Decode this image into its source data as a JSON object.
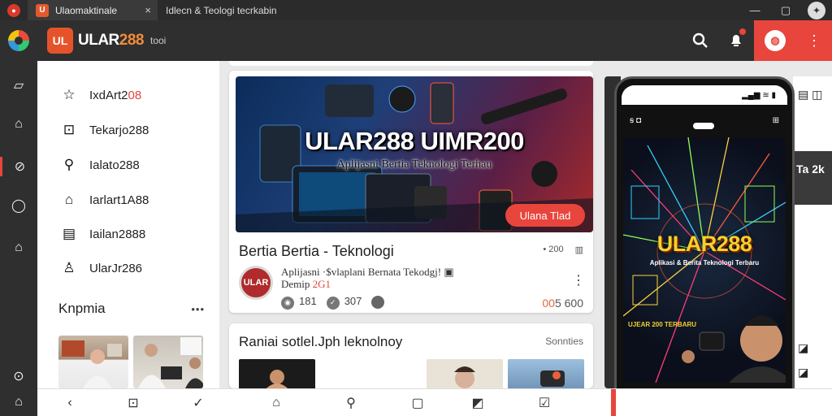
{
  "browser": {
    "tabs": [
      {
        "label": "Ulaomaktinale"
      },
      {
        "label": "Idlecn & Teologi tecrkabin"
      }
    ],
    "close_glyph": "×",
    "window_controls": [
      "—",
      "▢"
    ]
  },
  "header": {
    "brand_mark": "UL",
    "brand_name_a": "ULAR",
    "brand_name_b": "288",
    "brand_sub": "tooi",
    "icons": [
      "search-icon",
      "notification-icon",
      "profile-icon",
      "more-icon"
    ]
  },
  "sidebar": {
    "items": [
      {
        "icon": "star-icon",
        "glyph": "☆",
        "label_a": "IxdArt2",
        "label_b": "08"
      },
      {
        "icon": "bookmark-icon",
        "glyph": "⊡",
        "label_a": "Tekarjo288",
        "label_b": ""
      },
      {
        "icon": "user-icon",
        "glyph": "⚲",
        "label_a": "Ialato288",
        "label_b": ""
      },
      {
        "icon": "lock-icon",
        "glyph": "⌂",
        "label_a": "Iarlart1A88",
        "label_b": ""
      },
      {
        "icon": "file-icon",
        "glyph": "▤",
        "label_a": "Iailan2888",
        "label_b": ""
      },
      {
        "icon": "person-icon",
        "glyph": "♙",
        "label_a": "UlarJr286",
        "label_b": ""
      }
    ],
    "section_title": "Knpmia",
    "section_more": "•••"
  },
  "main": {
    "hero": {
      "title": "ULAR288 UIMR200",
      "subtitle": "Aplijasni Bertia Teknologi Terhau",
      "button": "Ulana Tlad"
    },
    "card": {
      "title": "Bertia Bertia - Teknologi",
      "meta_left": "• 200",
      "meta_right": "▥",
      "avatar_text": "ULAR",
      "desc_line1": "Aplijasni ·$vlaplani Bernata Tekodgj! ",
      "desc_line2_a": "Demip ",
      "desc_line2_b": "2G1",
      "desc_extra": "▣",
      "stats": [
        {
          "icon": "views-icon",
          "value": "181"
        },
        {
          "icon": "check-icon",
          "value": "307"
        }
      ],
      "price_a": "0",
      "price_b": "5 600",
      "price_prefix": "0"
    },
    "card2": {
      "title": "Raniai sotlel.Jph leknolnoy",
      "more": "Sonnties"
    }
  },
  "phone": {
    "status_icons": "▂▄▆ ≋ ▮",
    "top_left": "ꞩ ◘",
    "top_right": "⊞",
    "title": "ULAR288",
    "subtitle": "Aplikasi & Berita Teknologi Terbaru",
    "tag": "UJEAR 200 TERBARU",
    "nav": [
      "◀",
      "●",
      "■"
    ]
  },
  "right_panel": {
    "dark_text": "Ta\n2k"
  },
  "colors": {
    "accent": "#e8453c",
    "brand_orange": "#e6532b",
    "dark_chrome": "#2f2f2f",
    "gold": "#f2d22a"
  }
}
